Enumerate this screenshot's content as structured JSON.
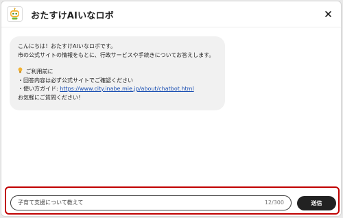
{
  "header": {
    "title": "おたすけAIいなロボ",
    "logo_icon": "robot-icon",
    "close_icon": "close-icon"
  },
  "message": {
    "greeting": "こんにちは！おたすけAIいなロボです。",
    "intro": "市の公式サイトの情報をもとに、行政サービスや手続きについてお答えします。",
    "notice_icon": "lightbulb-icon",
    "notice_title": "ご利用前に",
    "item1": "・回答内容は必ず公式サイトでご確認ください",
    "item2_label": "・使い方ガイド: ",
    "item2_link": "https://www.city.inabe.mie.jp/about/chatbot.html",
    "closing": "お気軽にご質問ください！"
  },
  "input": {
    "value": "子育て支援について教えて",
    "counter": "12/300"
  },
  "send_label": "送信",
  "colors": {
    "highlight": "#c00000",
    "send_button": "#222222",
    "link": "#1a4fb3"
  }
}
